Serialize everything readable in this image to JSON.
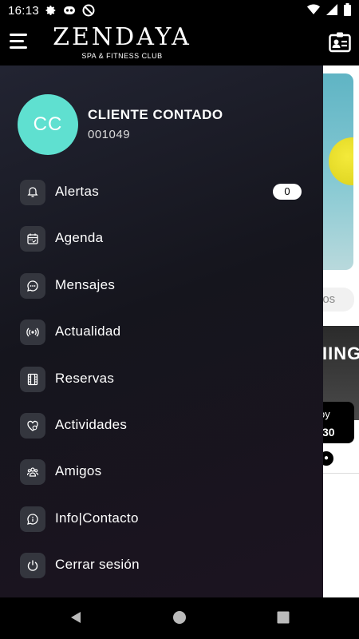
{
  "status_bar": {
    "time": "16:13"
  },
  "app": {
    "brand": "ZENDAYA",
    "subtitle": "SPA & FITNESS CLUB"
  },
  "profile": {
    "initials": "CC",
    "name": "CLIENTE CONTADO",
    "id": "001049",
    "avatar_color": "#5fe0d0"
  },
  "menu": [
    {
      "label": "Alertas",
      "icon": "bell-icon",
      "badge": "0"
    },
    {
      "label": "Agenda",
      "icon": "calendar-icon"
    },
    {
      "label": "Mensajes",
      "icon": "chat-icon"
    },
    {
      "label": "Actualidad",
      "icon": "broadcast-icon"
    },
    {
      "label": "Reservas",
      "icon": "film-icon"
    },
    {
      "label": "Actividades",
      "icon": "heart-icon"
    },
    {
      "label": "Amigos",
      "icon": "group-icon"
    },
    {
      "label": "Info|Contacto",
      "icon": "chat-bubble-icon"
    },
    {
      "label": "Cerrar sesión",
      "icon": "power-icon"
    }
  ],
  "background": {
    "chip_text": "dos",
    "card_title": "IING",
    "card_line1": "oy",
    "card_line2": "30"
  }
}
